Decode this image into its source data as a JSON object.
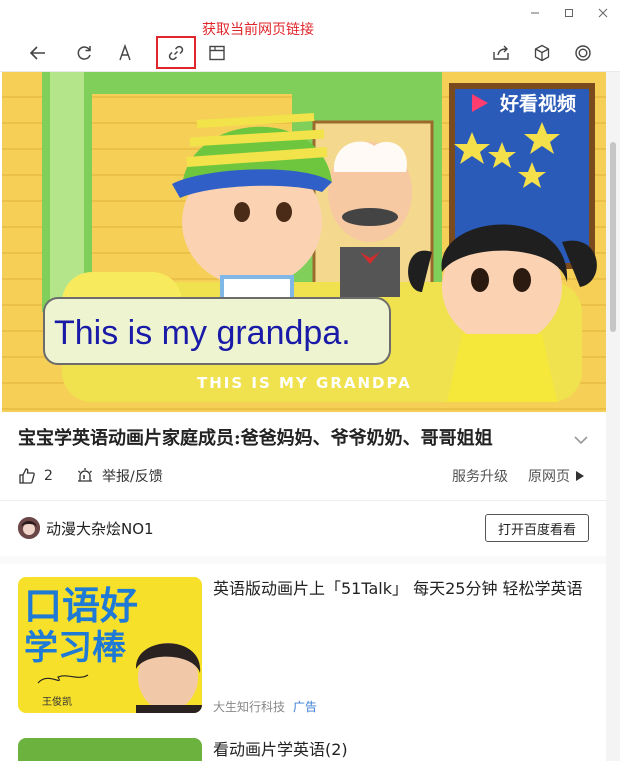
{
  "annotation": {
    "label": "获取当前网页链接"
  },
  "video": {
    "watermark": "好看视频",
    "subtitle_main": "This is my grandpa.",
    "subtitle_caps": "THIS IS MY GRANDPA"
  },
  "article": {
    "title": "宝宝学英语动画片家庭成员:爸爸妈妈、爷爷奶奶、哥哥姐姐",
    "likes": "2",
    "report": "举报/反馈",
    "upgrade": "服务升级",
    "original": "原网页"
  },
  "author": {
    "name": "动漫大杂烩NO1",
    "open_button": "打开百度看看"
  },
  "recommendations": [
    {
      "title": "英语版动画片上「51Talk」 每天25分钟 轻松学英语",
      "source": "大生知行科技",
      "tag": "广告",
      "thumb_text_1": "口语好",
      "thumb_text_2": "学习棒",
      "thumb_caption": "王俊凯"
    },
    {
      "title": "看动画片学英语(2)"
    }
  ]
}
